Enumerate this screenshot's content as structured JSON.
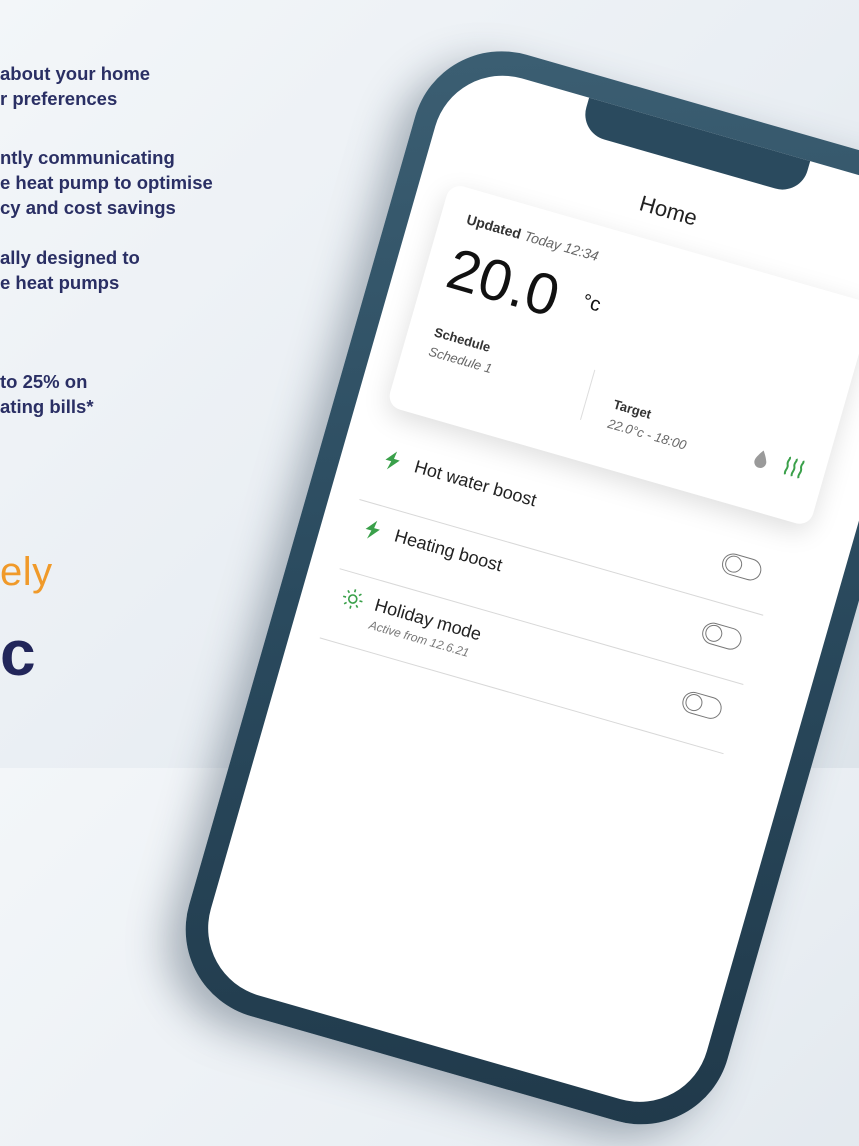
{
  "marketing": {
    "bullets": [
      {
        "line1": "about your home",
        "line2": "r preferences"
      },
      {
        "line1": "ntly communicating",
        "line2": "e heat pump to optimise",
        "line3": "cy and cost savings"
      },
      {
        "line1": "ally designed to",
        "line2": "e heat pumps"
      },
      {
        "line1": "to 25% on",
        "line2": "ating bills*"
      }
    ],
    "brand_word": "ely",
    "brand_mark": "c"
  },
  "app": {
    "title": "Home",
    "card": {
      "updated_label": "Updated",
      "updated_value": "Today 12:34",
      "temperature": "20.0",
      "unit": "°c",
      "schedule_label": "Schedule",
      "schedule_value": "Schedule 1",
      "target_label": "Target",
      "target_value": "22.0°c - 18:00",
      "icons": [
        "water-drop-icon",
        "heating-icon"
      ]
    },
    "rows": [
      {
        "title": "Hot water boost",
        "subtitle": "",
        "icon": "lightning-icon",
        "toggle_on": false
      },
      {
        "title": "Heating boost",
        "subtitle": "",
        "icon": "lightning-icon",
        "toggle_on": false
      },
      {
        "title": "Holiday mode",
        "subtitle": "Active from 12.6.21",
        "icon": "sun-icon",
        "toggle_on": false
      }
    ]
  },
  "colors": {
    "navy_text": "#2a2f64",
    "brand_orange": "#f09a2a",
    "accent_green": "#3aa04a",
    "phone_frame": "#2a4a5e"
  }
}
